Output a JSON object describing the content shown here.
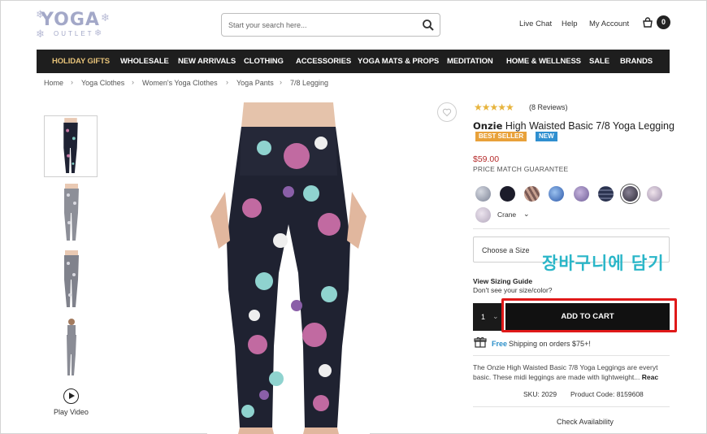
{
  "header": {
    "logo_main": "YOGA",
    "logo_sub": "OUTLET",
    "search_placeholder": "Start your search here...",
    "live_chat": "Live Chat",
    "help": "Help",
    "my_account": "My Account",
    "cart_count": "0"
  },
  "nav": {
    "items": [
      {
        "label": "HOLIDAY GIFTS",
        "highlight": true
      },
      {
        "label": "WHOLESALE"
      },
      {
        "label": "NEW ARRIVALS"
      },
      {
        "label": "CLOTHING"
      },
      {
        "label": "ACCESSORIES"
      },
      {
        "label": "YOGA MATS & PROPS"
      },
      {
        "label": "MEDITATION"
      },
      {
        "label": "HOME & WELLNESS"
      },
      {
        "label": "SALE"
      },
      {
        "label": "BRANDS"
      }
    ],
    "highlight_color": "#e6c278"
  },
  "breadcrumb": [
    "Home",
    "Yoga Clothes",
    "Women's Yoga Clothes",
    "Yoga Pants",
    "7/8 Legging"
  ],
  "gallery": {
    "play_video": "Play Video"
  },
  "product": {
    "rating": 4.5,
    "reviews": "(8 Reviews)",
    "brand": "Onzie",
    "name": "High Waisted Basic 7/8 Yoga Legging",
    "badges": [
      {
        "label": "BEST SELLER",
        "color": "#e8a13a"
      },
      {
        "label": "NEW",
        "color": "#2f8fd0"
      }
    ],
    "price": "$59.00",
    "price_match": "PRICE MATCH GUARANTEE",
    "color_name": "Crane",
    "size_placeholder": "Choose a Size",
    "sizing_guide": "View Sizing Guide",
    "dont_see": "Don't see your size/color?",
    "qty": "1",
    "add_to_cart": "ADD TO CART",
    "shipping_free": "Free",
    "shipping_text": "Shipping on orders $75+!",
    "description_line1": "The Onzie High Waisted Basic 7/8 Yoga Leggings are everyt",
    "description_line2": "basic. These midi leggings are made with lightweight...",
    "read_more": "Reac",
    "sku": "SKU: 2029",
    "product_code": "Product Code: 8159608",
    "check_availability": "Check Availability"
  },
  "overlay": {
    "korean_caption": "장바구니에 담기",
    "caption_color": "#2ab6c8",
    "highlight_color": "#e01919"
  }
}
